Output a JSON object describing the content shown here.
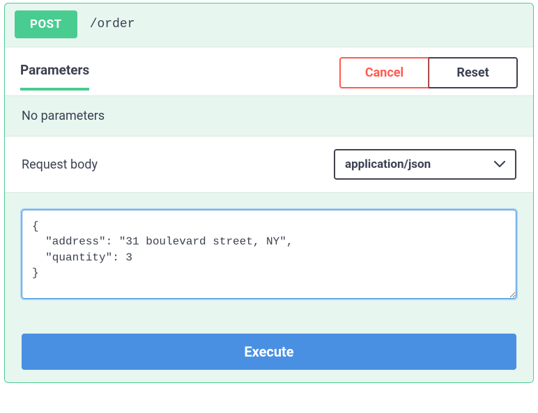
{
  "operation": {
    "method": "POST",
    "path": "/order"
  },
  "tabs": {
    "parameters": "Parameters"
  },
  "actions": {
    "cancel": "Cancel",
    "reset": "Reset",
    "execute": "Execute"
  },
  "parameters": {
    "empty_message": "No parameters"
  },
  "request_body": {
    "label": "Request body",
    "content_type": "application/json",
    "value": "{\n  \"address\": \"31 boulevard street, NY\",\n  \"quantity\": 3\n}"
  }
}
